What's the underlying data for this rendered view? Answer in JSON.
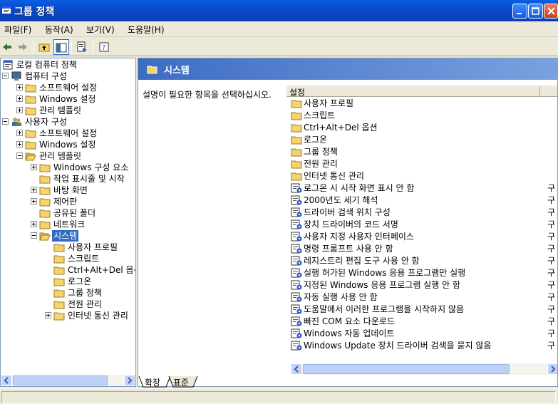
{
  "window": {
    "title": "그룹 정책"
  },
  "menu": [
    "파일(F)",
    "동작(A)",
    "보기(V)",
    "도움말(H)"
  ],
  "tree": {
    "items": [
      {
        "label": "로컬 컴퓨터 정책",
        "icon": "policy-icon"
      },
      {
        "label": "컴퓨터 구성",
        "icon": "computer-icon"
      },
      {
        "label": "소프트웨어 설정",
        "icon": "folder-icon"
      },
      {
        "label": "Windows 설정",
        "icon": "folder-icon"
      },
      {
        "label": "관리 템플릿",
        "icon": "folder-icon"
      },
      {
        "label": "사용자 구성",
        "icon": "users-icon"
      },
      {
        "label": "소프트웨어 설정",
        "icon": "folder-icon"
      },
      {
        "label": "Windows 설정",
        "icon": "folder-icon"
      },
      {
        "label": "관리 템플릿",
        "icon": "folder-open-icon"
      },
      {
        "label": "Windows 구성 요소",
        "icon": "folder-icon"
      },
      {
        "label": "작업 표시줄 및 시작",
        "icon": "folder-icon"
      },
      {
        "label": "바탕 화면",
        "icon": "folder-icon"
      },
      {
        "label": "제어판",
        "icon": "folder-icon"
      },
      {
        "label": "공유된 폴더",
        "icon": "folder-icon"
      },
      {
        "label": "네트워크",
        "icon": "folder-icon"
      },
      {
        "label": "시스템",
        "icon": "folder-open-icon",
        "selected": true
      },
      {
        "label": "사용자 프로필",
        "icon": "folder-icon"
      },
      {
        "label": "스크립트",
        "icon": "folder-icon"
      },
      {
        "label": "Ctrl+Alt+Del 옵션",
        "icon": "folder-icon"
      },
      {
        "label": "로그온",
        "icon": "folder-icon"
      },
      {
        "label": "그룹 정책",
        "icon": "folder-icon"
      },
      {
        "label": "전원 관리",
        "icon": "folder-icon"
      },
      {
        "label": "인터넷 통신 관리",
        "icon": "folder-icon"
      }
    ]
  },
  "right": {
    "header_title": "시스템",
    "description": "설명이 필요한 항목을 선택하십시오.",
    "column_setting": "설정",
    "items": [
      {
        "label": "사용자 프로필",
        "type": "folder",
        "state": ""
      },
      {
        "label": "스크립트",
        "type": "folder",
        "state": ""
      },
      {
        "label": "Ctrl+Alt+Del 옵션",
        "type": "folder",
        "state": ""
      },
      {
        "label": "로그온",
        "type": "folder",
        "state": ""
      },
      {
        "label": "그룹 정책",
        "type": "folder",
        "state": ""
      },
      {
        "label": "전원 관리",
        "type": "folder",
        "state": ""
      },
      {
        "label": "인터넷 통신 관리",
        "type": "folder",
        "state": ""
      },
      {
        "label": "로그온 시 시작 화면 표시 안 함",
        "type": "setting",
        "state": "구"
      },
      {
        "label": "2000년도 세기 해석",
        "type": "setting",
        "state": "구"
      },
      {
        "label": "드라이버 검색 위치 구성",
        "type": "setting",
        "state": "구"
      },
      {
        "label": "장치 드라이버의 코드 서명",
        "type": "setting",
        "state": "구"
      },
      {
        "label": "사용자 지정 사용자 인터페이스",
        "type": "setting",
        "state": "구"
      },
      {
        "label": "명령 프롬프트 사용 안 함",
        "type": "setting",
        "state": "구"
      },
      {
        "label": "레지스트리 편집 도구 사용 안 함",
        "type": "setting",
        "state": "구"
      },
      {
        "label": "실행 허가된 Windows 응용 프로그램만 실행",
        "type": "setting",
        "state": "구"
      },
      {
        "label": "지정된 Windows 응용 프로그램 실행 안 함",
        "type": "setting",
        "state": "구"
      },
      {
        "label": "자동 실행 사용 안 함",
        "type": "setting",
        "state": "구"
      },
      {
        "label": "도움말에서 이러한 프로그램을 시작하지 않음",
        "type": "setting",
        "state": "구"
      },
      {
        "label": "빠진 COM 요소 다운로드",
        "type": "setting",
        "state": "구"
      },
      {
        "label": "Windows 자동 업데이트",
        "type": "setting",
        "state": "구"
      },
      {
        "label": "Windows Update 장치 드라이버 검색을 묻지 않음",
        "type": "setting",
        "state": "구"
      }
    ]
  },
  "tabs": {
    "expanded": "확장",
    "standard": "표준"
  },
  "colors": {
    "titlebar": "#0a5fe0",
    "selection": "#316ac5",
    "folder": "#f5d46e"
  }
}
